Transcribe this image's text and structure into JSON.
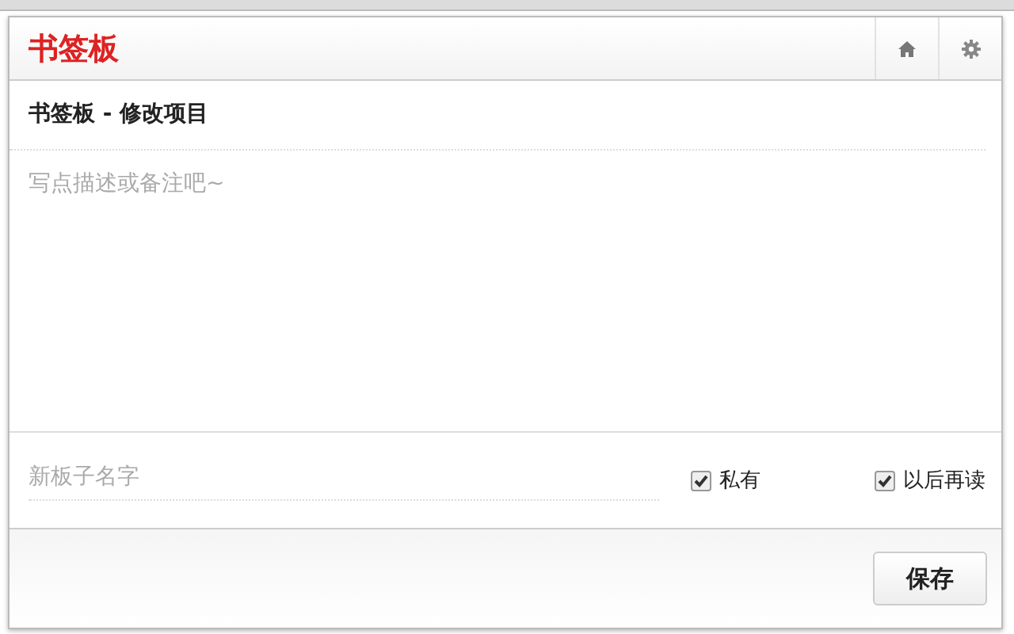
{
  "header": {
    "title": "书签板"
  },
  "subtitle": "书签板 - 修改项目",
  "description": {
    "placeholder": "写点描述或备注吧~"
  },
  "board_name": {
    "placeholder": "新板子名字"
  },
  "options": [
    {
      "label": "私有",
      "checked": true
    },
    {
      "label": "以后再读",
      "checked": true
    }
  ],
  "save_button": "保存"
}
